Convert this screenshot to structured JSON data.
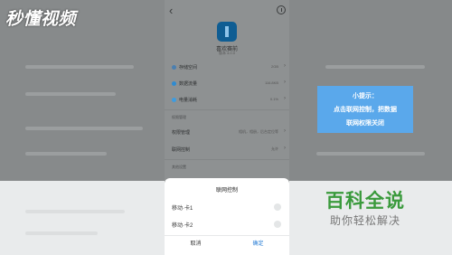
{
  "watermark": {
    "text": "秒懂视频"
  },
  "header": {
    "back_icon": "chevron-left-icon",
    "info_icon": "info-icon"
  },
  "app": {
    "name": "喜欢赛前",
    "version": "版本 4.0.0"
  },
  "rows": [
    {
      "label": "存储空间",
      "value": "2GB",
      "icon_color": "#4a7fb0"
    },
    {
      "label": "数据流量",
      "value": "116.8KB",
      "icon_color": "#2f8bd1"
    },
    {
      "label": "电量消耗",
      "value": "0.1%",
      "icon_color": "#3d9ce0"
    }
  ],
  "section_permissions": "权限管理",
  "rows_perm": [
    {
      "label": "权限管理",
      "value": "相机，相册，后台定位等"
    },
    {
      "label": "联网控制",
      "value": "允许"
    }
  ],
  "section_other": "其他设置",
  "dialog": {
    "title": "联网控制",
    "options": [
      "移动·卡1",
      "移动·卡2"
    ],
    "cancel": "取消",
    "confirm": "确定"
  },
  "tip": {
    "line1": "小提示：",
    "line2": "点击联网控制，把数据",
    "line3": "联网权限关闭"
  },
  "brand": {
    "title": "百科全说",
    "subtitle": "助你轻松解决"
  },
  "colors": {
    "tip_bg": "#5aa8eb",
    "brand_green": "#3a9a3c",
    "confirm_blue": "#2b7fd6"
  }
}
